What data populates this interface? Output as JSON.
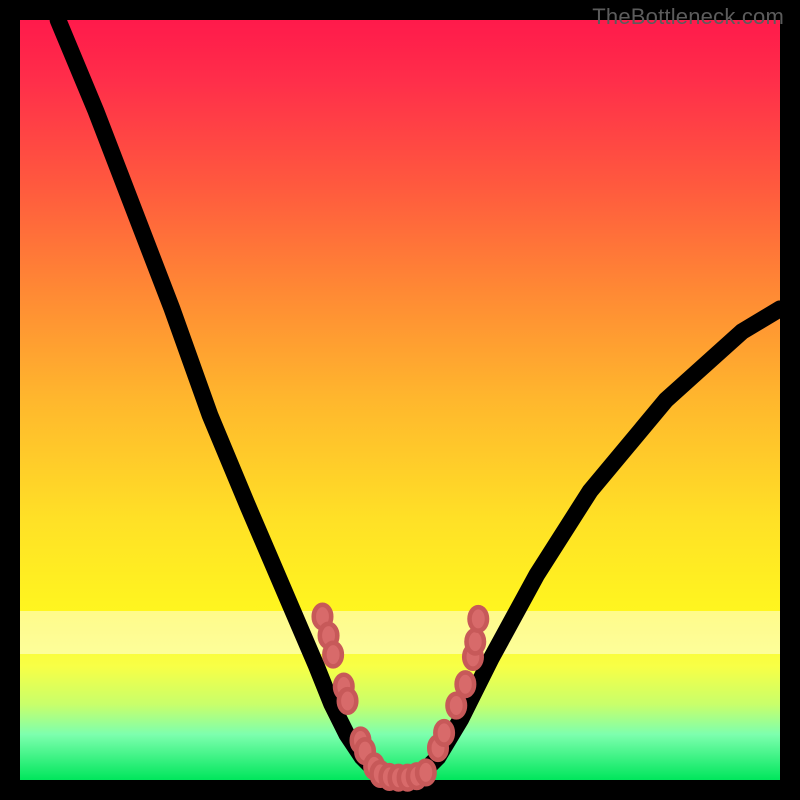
{
  "attribution": "TheBottleneck.com",
  "colors": {
    "background": "#000000",
    "marker_fill": "#d86a6a",
    "marker_stroke": "#c75959",
    "curve_stroke": "#000000"
  },
  "chart_data": {
    "type": "line",
    "title": "",
    "xlabel": "",
    "ylabel": "",
    "xlim": [
      0,
      100
    ],
    "ylim": [
      0,
      100
    ],
    "grid": false,
    "legend": false,
    "series": [
      {
        "name": "bottleneck-curve",
        "x": [
          5,
          10,
          15,
          20,
          25,
          30,
          33,
          36,
          39,
          41,
          43,
          45,
          47,
          49,
          51,
          53,
          55,
          58,
          62,
          68,
          75,
          85,
          95,
          100
        ],
        "y": [
          100,
          88,
          75,
          62,
          48,
          36,
          29,
          22,
          15,
          10,
          6,
          3,
          1,
          0,
          0,
          1,
          3,
          8,
          16,
          27,
          38,
          50,
          59,
          62
        ]
      }
    ],
    "markers_left": [
      {
        "x": 39.8,
        "y": 21.5
      },
      {
        "x": 40.6,
        "y": 19.0
      },
      {
        "x": 41.2,
        "y": 16.5
      },
      {
        "x": 42.6,
        "y": 12.3
      },
      {
        "x": 43.1,
        "y": 10.4
      },
      {
        "x": 44.8,
        "y": 5.2
      },
      {
        "x": 45.4,
        "y": 3.8
      },
      {
        "x": 46.6,
        "y": 1.8
      }
    ],
    "markers_right": [
      {
        "x": 55.0,
        "y": 4.2
      },
      {
        "x": 55.8,
        "y": 6.2
      },
      {
        "x": 57.4,
        "y": 9.8
      },
      {
        "x": 58.6,
        "y": 12.6
      },
      {
        "x": 59.6,
        "y": 16.2
      },
      {
        "x": 59.9,
        "y": 18.2
      },
      {
        "x": 60.3,
        "y": 21.2
      }
    ],
    "markers_bottom": [
      {
        "x": 47.4,
        "y": 0.8
      },
      {
        "x": 48.6,
        "y": 0.4
      },
      {
        "x": 49.8,
        "y": 0.3
      },
      {
        "x": 51.0,
        "y": 0.3
      },
      {
        "x": 52.2,
        "y": 0.5
      },
      {
        "x": 53.4,
        "y": 1.0
      }
    ]
  }
}
